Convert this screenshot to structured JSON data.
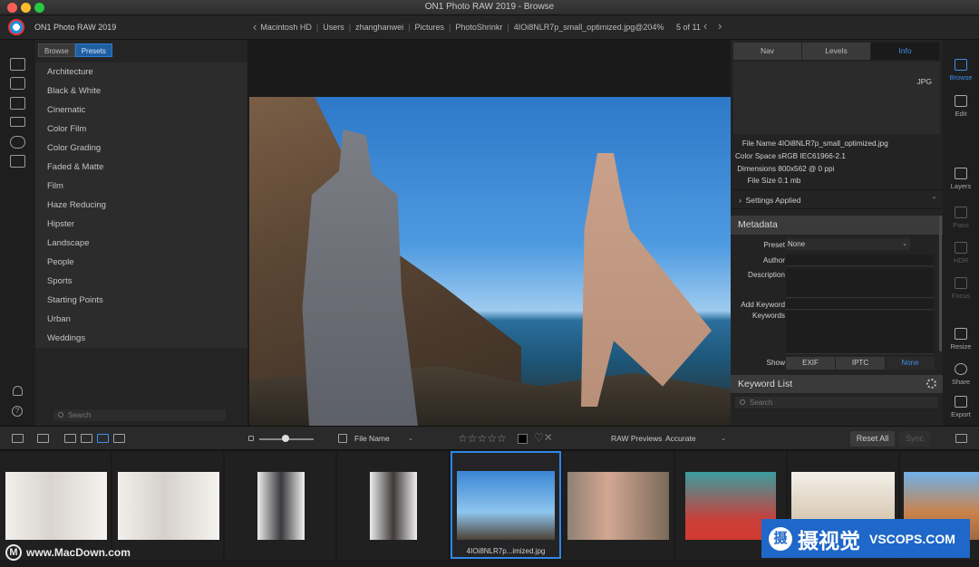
{
  "window": {
    "title": "ON1 Photo RAW 2019 - Browse"
  },
  "topbar": {
    "app_name": "ON1 Photo RAW 2019",
    "breadcrumb": [
      "Macintosh HD",
      "Users",
      "zhanghanwei",
      "Pictures",
      "PhotoShrinkr",
      "4IOi8NLR7p_small_optimized.jpg@204%"
    ],
    "page_count": "5 of 11"
  },
  "preset_panel": {
    "tabs": [
      {
        "label": "Browse",
        "active": false
      },
      {
        "label": "Presets",
        "active": true
      }
    ],
    "items": [
      "Architecture",
      "Black & White",
      "Cinematic",
      "Color Film",
      "Color Grading",
      "Faded & Matte",
      "Film",
      "Haze Reducing",
      "Hipster",
      "Landscape",
      "People",
      "Sports",
      "Starting Points",
      "Urban",
      "Weddings"
    ],
    "search_placeholder": "Search"
  },
  "info_panel": {
    "tabs": [
      {
        "label": "Nav",
        "active": false
      },
      {
        "label": "Levels",
        "active": false
      },
      {
        "label": "Info",
        "active": true
      }
    ],
    "format": "JPG",
    "file_name_label": "File Name",
    "file_name": "4IOi8NLR7p_small_optimized.jpg",
    "color_space_label": "Color Space",
    "color_space": "sRGB IEC61966-2.1",
    "dimensions_label": "Dimensions",
    "dimensions": "800x562 @ 0 ppi",
    "file_size_label": "File Size",
    "file_size": "0.1 mb",
    "settings_applied": "Settings Applied",
    "metadata_title": "Metadata",
    "preset_label": "Preset",
    "preset_value": "None",
    "author_label": "Author",
    "description_label": "Description",
    "add_keyword_label": "Add Keyword",
    "keywords_label": "Keywords",
    "show_label": "Show",
    "show_options": [
      {
        "label": "EXIF",
        "active": false
      },
      {
        "label": "IPTC",
        "active": false
      },
      {
        "label": "None",
        "active": true
      }
    ],
    "keyword_list_title": "Keyword List",
    "keyword_search_placeholder": "Search"
  },
  "right_rail": [
    {
      "label": "Browse",
      "icon": "browse-icon",
      "state": "active"
    },
    {
      "label": "Edit",
      "icon": "edit-sliders-icon",
      "state": "normal"
    },
    {
      "label": "Layers",
      "icon": "layers-icon",
      "state": "normal"
    },
    {
      "label": "Pano",
      "icon": "pano-icon",
      "state": "dim"
    },
    {
      "label": "HDR",
      "icon": "hdr-icon",
      "state": "dim"
    },
    {
      "label": "Focus",
      "icon": "focus-icon",
      "state": "dim"
    },
    {
      "label": "Resize",
      "icon": "resize-icon",
      "state": "normal"
    },
    {
      "label": "Share",
      "icon": "share-icon",
      "state": "normal"
    },
    {
      "label": "Export",
      "icon": "export-icon",
      "state": "normal"
    }
  ],
  "toolbar": {
    "sort_value": "File Name",
    "stars": "☆☆☆☆☆",
    "raw_label": "RAW Previews",
    "raw_value": "Accurate",
    "reset_all": "Reset All",
    "sync": "Sync"
  },
  "filmstrip": {
    "selected_label": "4IOi8NLR7p...imized.jpg"
  },
  "watermarks": {
    "macdown": "www.MacDown.com",
    "vscops_cn": "摄视觉",
    "vscops_en": "VSCOPS.COM"
  },
  "colors": {
    "accent": "#2e88e6",
    "panel": "#232324",
    "background": "#1b1b1c"
  }
}
